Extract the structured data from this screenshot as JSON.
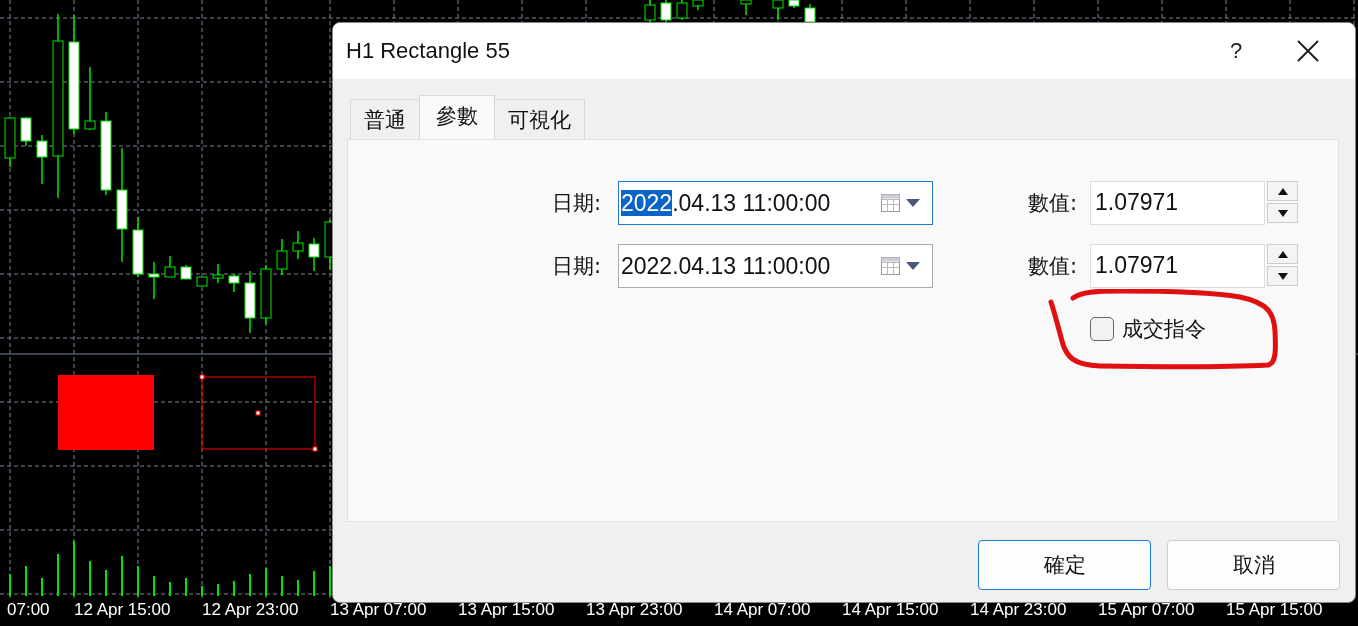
{
  "window": {
    "title": "H1 Rectangle 55",
    "help": "?"
  },
  "tabs": [
    {
      "label": "普通",
      "selected": false
    },
    {
      "label": "參數",
      "selected": true
    },
    {
      "label": "可視化",
      "selected": false
    }
  ],
  "anchors": [
    {
      "date_label": "日期:",
      "focused": true,
      "date_parts": [
        {
          "text": "2022",
          "selected": true
        },
        {
          "text": ".04.13 11:00:00",
          "selected": false
        }
      ],
      "value_label": "數值:",
      "value": "1.07971"
    },
    {
      "date_label": "日期:",
      "focused": false,
      "date_parts": [
        {
          "text": "2022.04.13 11:00:00",
          "selected": false
        }
      ],
      "value_label": "數值:",
      "value": "1.07971"
    }
  ],
  "checkbox": {
    "label": "成交指令",
    "checked": false
  },
  "buttons": [
    {
      "label": "確定",
      "default": true
    },
    {
      "label": "取消",
      "default": false
    }
  ],
  "time_axis": [
    "07:00",
    "12 Apr 15:00",
    "12 Apr 23:00",
    "13 Apr 07:00",
    "13 Apr 15:00",
    "13 Apr 23:00",
    "14 Apr 07:00",
    "14 Apr 15:00",
    "14 Apr 23:00",
    "15 Apr 07:00",
    "15 Apr 15:00"
  ]
}
